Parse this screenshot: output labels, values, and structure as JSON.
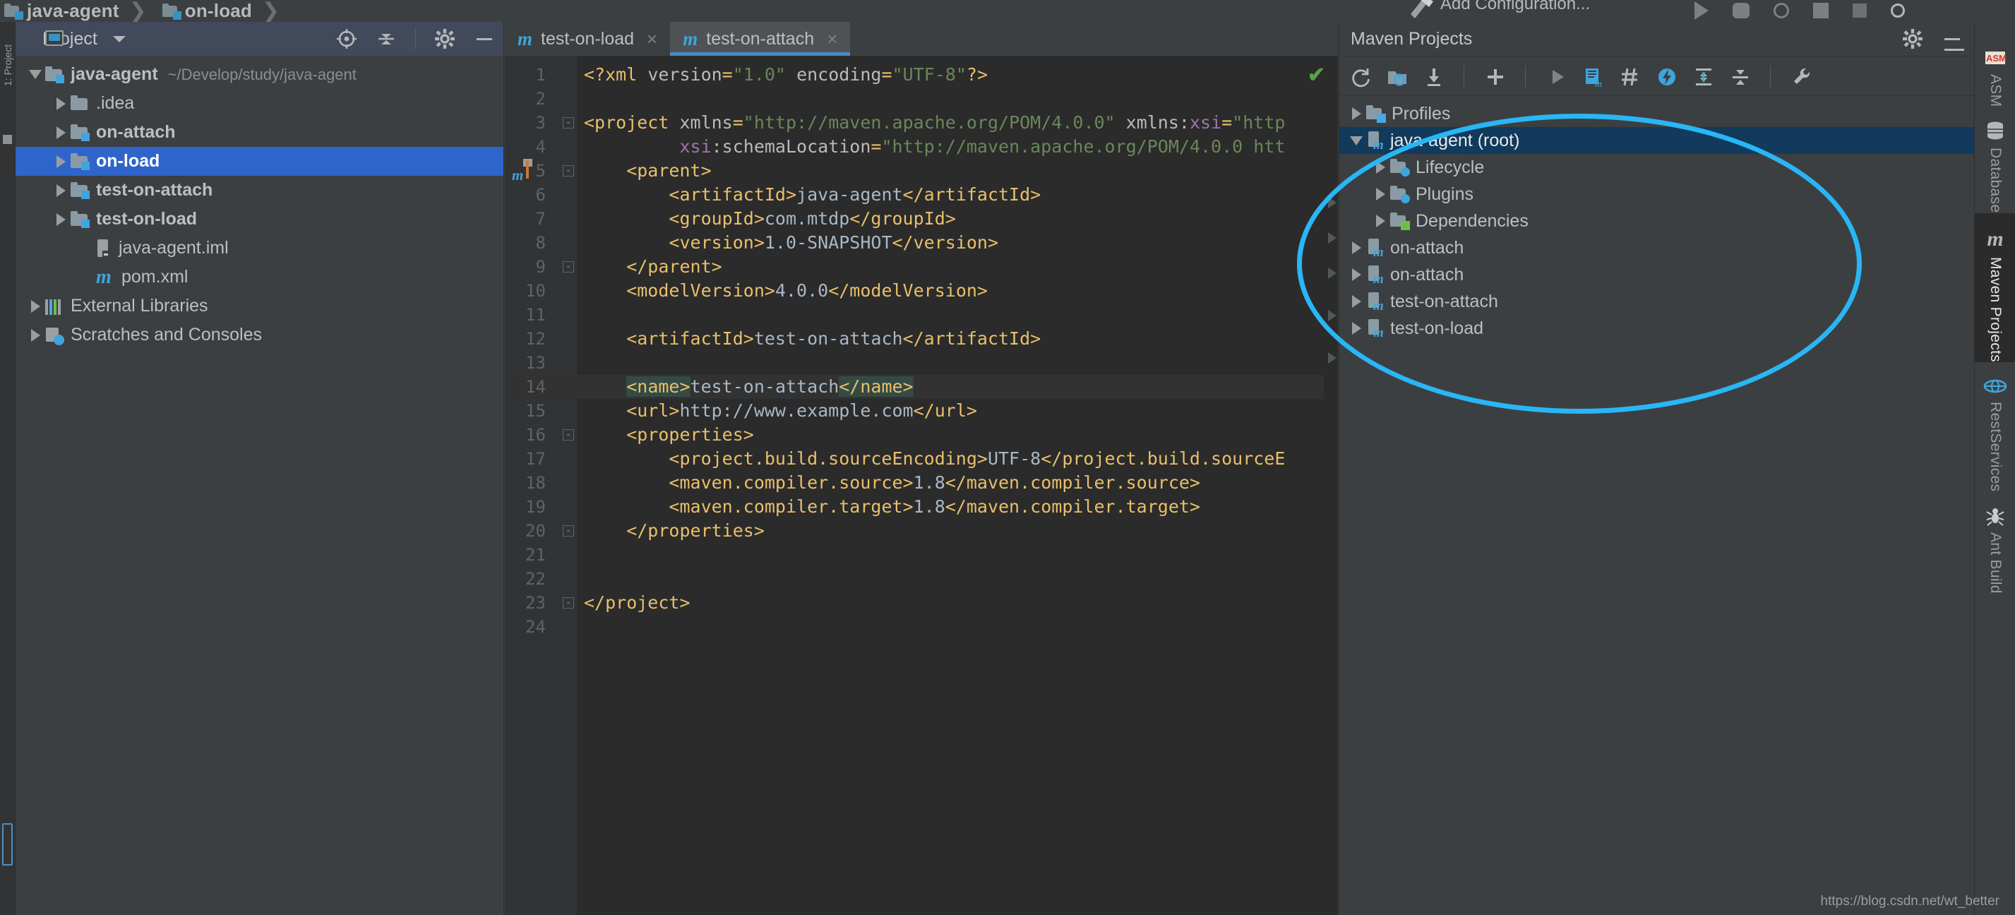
{
  "breadcrumb": {
    "items": [
      {
        "label": "java-agent",
        "icon": "module-icon"
      },
      {
        "label": "on-load",
        "icon": "module-icon"
      }
    ],
    "add_configuration": "Add Configuration..."
  },
  "left_strip": {
    "label": "1: Project"
  },
  "project_panel": {
    "title": "Project",
    "tools": [
      {
        "name": "locate-icon"
      },
      {
        "name": "collapse-all-icon"
      },
      {
        "name": "gear-icon"
      },
      {
        "name": "hide-icon"
      }
    ],
    "tree": [
      {
        "label": "java-agent",
        "path": "~/Develop/study/java-agent",
        "icon": "module-folder-icon",
        "expanded": true,
        "indent": 0,
        "bold": true,
        "selected": false
      },
      {
        "label": ".idea",
        "path": "",
        "icon": "folder-icon",
        "expanded": false,
        "indent": 1,
        "bold": false,
        "selected": false
      },
      {
        "label": "on-attach",
        "path": "",
        "icon": "module-folder-icon",
        "expanded": false,
        "indent": 1,
        "bold": true,
        "selected": false
      },
      {
        "label": "on-load",
        "path": "",
        "icon": "module-folder-icon",
        "expanded": false,
        "indent": 1,
        "bold": true,
        "selected": true
      },
      {
        "label": "test-on-attach",
        "path": "",
        "icon": "module-folder-icon",
        "expanded": false,
        "indent": 1,
        "bold": true,
        "selected": false
      },
      {
        "label": "test-on-load",
        "path": "",
        "icon": "module-folder-icon",
        "expanded": false,
        "indent": 1,
        "bold": true,
        "selected": false
      },
      {
        "label": "java-agent.iml",
        "path": "",
        "icon": "iml-file-icon",
        "expanded": null,
        "indent": 2,
        "bold": false,
        "selected": false
      },
      {
        "label": "pom.xml",
        "path": "",
        "icon": "maven-file-icon",
        "expanded": null,
        "indent": 2,
        "bold": false,
        "selected": false
      },
      {
        "label": "External Libraries",
        "path": "",
        "icon": "library-icon",
        "expanded": false,
        "indent": 0,
        "bold": false,
        "selected": false
      },
      {
        "label": "Scratches and Consoles",
        "path": "",
        "icon": "scratches-icon",
        "expanded": false,
        "indent": 0,
        "bold": false,
        "selected": false
      }
    ]
  },
  "editor": {
    "tabs": [
      {
        "label": "test-on-load",
        "icon": "maven-file-icon",
        "active": false
      },
      {
        "label": "test-on-attach",
        "icon": "maven-file-icon",
        "active": true
      }
    ],
    "inspection_status": "✔",
    "lines": [
      {
        "num": "1",
        "indent": 0,
        "highlight": false,
        "fold": "",
        "segments": [
          {
            "t": "<?xml ",
            "c": "tok-br"
          },
          {
            "t": "version",
            "c": "tok-at"
          },
          {
            "t": "=",
            "c": "tok-br"
          },
          {
            "t": "\"1.0\"",
            "c": "tok-val"
          },
          {
            "t": " ",
            "c": "tok-at"
          },
          {
            "t": "encoding",
            "c": "tok-at"
          },
          {
            "t": "=",
            "c": "tok-br"
          },
          {
            "t": "\"UTF-8\"",
            "c": "tok-val"
          },
          {
            "t": "?>",
            "c": "tok-br"
          }
        ]
      },
      {
        "num": "2",
        "indent": 0,
        "highlight": false,
        "fold": "",
        "segments": []
      },
      {
        "num": "3",
        "indent": 0,
        "highlight": false,
        "fold": "-",
        "segments": [
          {
            "t": "<project ",
            "c": "tok-br"
          },
          {
            "t": "xmlns",
            "c": "tok-at"
          },
          {
            "t": "=",
            "c": "tok-br"
          },
          {
            "t": "\"http://maven.apache.org/POM/4.0.0\"",
            "c": "tok-val"
          },
          {
            "t": " ",
            "c": "tok-at"
          },
          {
            "t": "xmlns:",
            "c": "tok-at"
          },
          {
            "t": "xsi",
            "c": "tok-ns"
          },
          {
            "t": "=",
            "c": "tok-br"
          },
          {
            "t": "\"http",
            "c": "tok-val"
          }
        ]
      },
      {
        "num": "4",
        "indent": 0,
        "highlight": false,
        "fold": "",
        "segments": [
          {
            "t": "         ",
            "c": "tok-at"
          },
          {
            "t": "xsi",
            "c": "tok-ns"
          },
          {
            "t": ":schemaLocation",
            "c": "tok-at"
          },
          {
            "t": "=",
            "c": "tok-br"
          },
          {
            "t": "\"http://maven.apache.org/POM/4.0.0 htt",
            "c": "tok-val"
          }
        ]
      },
      {
        "num": "5",
        "indent": 0,
        "highlight": false,
        "fold": "-",
        "marker": "maven-change-marker",
        "segments": [
          {
            "t": "    <parent>",
            "c": "tok-br"
          }
        ]
      },
      {
        "num": "6",
        "indent": 0,
        "highlight": false,
        "fold": "",
        "segments": [
          {
            "t": "        <artifactId>",
            "c": "tok-br"
          },
          {
            "t": "java-agent",
            "c": "tok-txt"
          },
          {
            "t": "</artifactId>",
            "c": "tok-br"
          }
        ]
      },
      {
        "num": "7",
        "indent": 0,
        "highlight": false,
        "fold": "",
        "segments": [
          {
            "t": "        <groupId>",
            "c": "tok-br"
          },
          {
            "t": "com.mtdp",
            "c": "tok-txt"
          },
          {
            "t": "</groupId>",
            "c": "tok-br"
          }
        ]
      },
      {
        "num": "8",
        "indent": 0,
        "highlight": false,
        "fold": "",
        "segments": [
          {
            "t": "        <version>",
            "c": "tok-br"
          },
          {
            "t": "1.0-SNAPSHOT",
            "c": "tok-txt"
          },
          {
            "t": "</version>",
            "c": "tok-br"
          }
        ]
      },
      {
        "num": "9",
        "indent": 0,
        "highlight": false,
        "fold": "-",
        "segments": [
          {
            "t": "    </parent>",
            "c": "tok-br"
          }
        ]
      },
      {
        "num": "10",
        "indent": 0,
        "highlight": false,
        "fold": "",
        "segments": [
          {
            "t": "    <modelVersion>",
            "c": "tok-br"
          },
          {
            "t": "4.0.0",
            "c": "tok-txt"
          },
          {
            "t": "</modelVersion>",
            "c": "tok-br"
          }
        ]
      },
      {
        "num": "11",
        "indent": 0,
        "highlight": false,
        "fold": "",
        "segments": []
      },
      {
        "num": "12",
        "indent": 0,
        "highlight": false,
        "fold": "",
        "segments": [
          {
            "t": "    <artifactId>",
            "c": "tok-br"
          },
          {
            "t": "test-on-attach",
            "c": "tok-txt"
          },
          {
            "t": "</artifactId>",
            "c": "tok-br"
          }
        ]
      },
      {
        "num": "13",
        "indent": 0,
        "highlight": false,
        "fold": "",
        "segments": []
      },
      {
        "num": "14",
        "indent": 0,
        "highlight": true,
        "fold": "",
        "segments": [
          {
            "t": "    ",
            "c": "tok-br"
          },
          {
            "t": "<name>",
            "c": "tok-br sel-bg"
          },
          {
            "t": "test-on-attach",
            "c": "tok-txt"
          },
          {
            "t": "</name>",
            "c": "tok-br sel-bg"
          }
        ]
      },
      {
        "num": "15",
        "indent": 0,
        "highlight": false,
        "fold": "",
        "segments": [
          {
            "t": "    <url>",
            "c": "tok-br"
          },
          {
            "t": "http://www.example.com",
            "c": "tok-txt"
          },
          {
            "t": "</url>",
            "c": "tok-br"
          }
        ]
      },
      {
        "num": "16",
        "indent": 0,
        "highlight": false,
        "fold": "-",
        "segments": [
          {
            "t": "    <properties>",
            "c": "tok-br"
          }
        ]
      },
      {
        "num": "17",
        "indent": 0,
        "highlight": false,
        "fold": "",
        "segments": [
          {
            "t": "        <project.build.sourceEncoding>",
            "c": "tok-br"
          },
          {
            "t": "UTF-8",
            "c": "tok-txt"
          },
          {
            "t": "</project.build.sourceE",
            "c": "tok-br"
          }
        ]
      },
      {
        "num": "18",
        "indent": 0,
        "highlight": false,
        "fold": "",
        "segments": [
          {
            "t": "        <maven.compiler.source>",
            "c": "tok-br"
          },
          {
            "t": "1.8",
            "c": "tok-txt"
          },
          {
            "t": "</maven.compiler.source>",
            "c": "tok-br"
          }
        ]
      },
      {
        "num": "19",
        "indent": 0,
        "highlight": false,
        "fold": "",
        "segments": [
          {
            "t": "        <maven.compiler.target>",
            "c": "tok-br"
          },
          {
            "t": "1.8",
            "c": "tok-txt"
          },
          {
            "t": "</maven.compiler.target>",
            "c": "tok-br"
          }
        ]
      },
      {
        "num": "20",
        "indent": 0,
        "highlight": false,
        "fold": "-",
        "segments": [
          {
            "t": "    </properties>",
            "c": "tok-br"
          }
        ]
      },
      {
        "num": "21",
        "indent": 0,
        "highlight": false,
        "fold": "",
        "segments": []
      },
      {
        "num": "22",
        "indent": 0,
        "highlight": false,
        "fold": "",
        "segments": []
      },
      {
        "num": "23",
        "indent": 0,
        "highlight": false,
        "fold": "-",
        "segments": [
          {
            "t": "</project>",
            "c": "tok-br"
          }
        ]
      },
      {
        "num": "24",
        "indent": 0,
        "highlight": false,
        "fold": "",
        "segments": []
      }
    ]
  },
  "maven_panel": {
    "title": "Maven Projects",
    "header_tools": [
      {
        "name": "gear-icon"
      },
      {
        "name": "hide-icon"
      }
    ],
    "toolbar": [
      {
        "name": "reimport-icon"
      },
      {
        "name": "generate-sources-icon"
      },
      {
        "name": "download-sources-icon"
      },
      {
        "name": "add-maven-project-icon"
      },
      {
        "name": "run-icon"
      },
      {
        "name": "execute-goal-icon"
      },
      {
        "name": "toggle-skip-tests-icon"
      },
      {
        "name": "toggle-offline-icon"
      },
      {
        "name": "expand-all-icon"
      },
      {
        "name": "collapse-all-icon"
      },
      {
        "name": "maven-settings-icon"
      }
    ],
    "tree": [
      {
        "label": "Profiles",
        "icon": "profiles-folder-icon",
        "expanded": false,
        "indent": 0,
        "selected": false
      },
      {
        "label": "java-agent (root)",
        "icon": "maven-project-icon",
        "expanded": true,
        "indent": 0,
        "selected": true
      },
      {
        "label": "Lifecycle",
        "icon": "lifecycle-folder-icon",
        "expanded": false,
        "indent": 1,
        "selected": false
      },
      {
        "label": "Plugins",
        "icon": "plugins-folder-icon",
        "expanded": false,
        "indent": 1,
        "selected": false
      },
      {
        "label": "Dependencies",
        "icon": "dependencies-folder-icon",
        "expanded": false,
        "indent": 1,
        "selected": false
      },
      {
        "label": "on-attach",
        "icon": "maven-project-icon",
        "expanded": false,
        "indent": 0,
        "selected": false
      },
      {
        "label": "on-attach",
        "icon": "maven-project-icon",
        "expanded": false,
        "indent": 0,
        "selected": false
      },
      {
        "label": "test-on-attach",
        "icon": "maven-project-icon",
        "expanded": false,
        "indent": 0,
        "selected": false
      },
      {
        "label": "test-on-load",
        "icon": "maven-project-icon",
        "expanded": false,
        "indent": 0,
        "selected": false
      }
    ]
  },
  "right_strip": {
    "items": [
      {
        "label": "ASM",
        "icon": "asm-icon",
        "active": false
      },
      {
        "label": "Database",
        "icon": "database-icon",
        "active": false
      },
      {
        "label": "Maven Projects",
        "icon": "maven-icon",
        "active": true
      },
      {
        "label": "RestServices",
        "icon": "rest-services-icon",
        "active": false
      },
      {
        "label": "Ant Build",
        "icon": "ant-icon",
        "active": false
      }
    ]
  },
  "annotations": {
    "ellipse_color": "#29b6f6",
    "arrow_color": "#f2e318"
  },
  "watermark": "https://blog.csdn.net/wt_better"
}
